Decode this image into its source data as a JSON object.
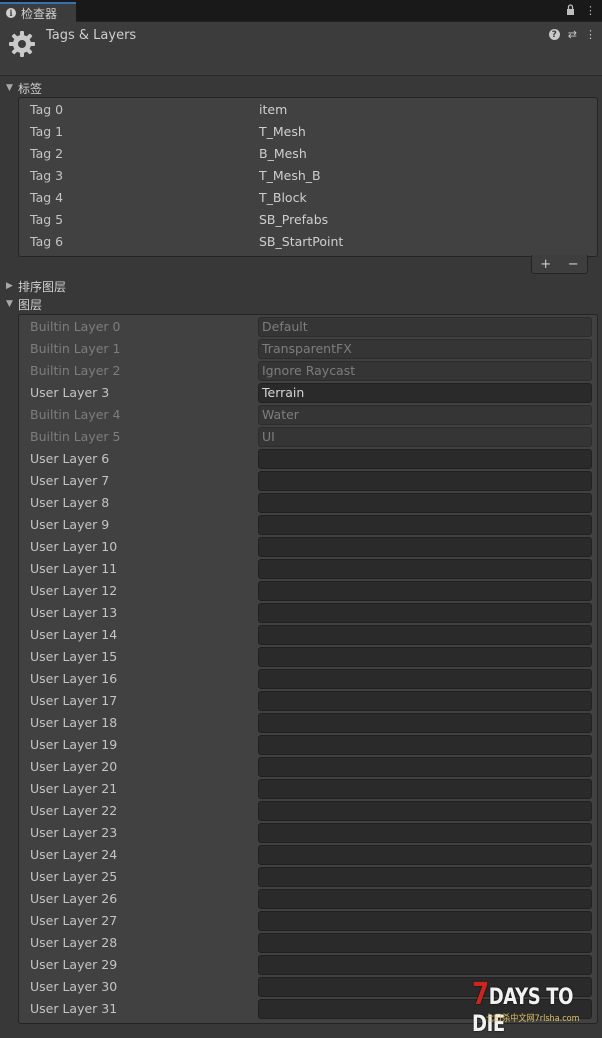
{
  "tab": {
    "label": "检查器"
  },
  "header": {
    "title": "Tags & Layers"
  },
  "tags_section": {
    "title": "标签",
    "items": [
      {
        "label": "Tag 0",
        "value": "item"
      },
      {
        "label": "Tag 1",
        "value": "T_Mesh"
      },
      {
        "label": "Tag 2",
        "value": "B_Mesh"
      },
      {
        "label": "Tag 3",
        "value": "T_Mesh_B"
      },
      {
        "label": "Tag 4",
        "value": "T_Block"
      },
      {
        "label": "Tag 5",
        "value": "SB_Prefabs"
      },
      {
        "label": "Tag 6",
        "value": "SB_StartPoint"
      }
    ],
    "add_label": "+",
    "remove_label": "−"
  },
  "sorting_section": {
    "title": "排序图层"
  },
  "layers_section": {
    "title": "图层",
    "items": [
      {
        "label": "Builtin Layer 0",
        "value": "Default",
        "disabled": true
      },
      {
        "label": "Builtin Layer 1",
        "value": "TransparentFX",
        "disabled": true
      },
      {
        "label": "Builtin Layer 2",
        "value": "Ignore Raycast",
        "disabled": true
      },
      {
        "label": "User Layer 3",
        "value": "Terrain",
        "disabled": false
      },
      {
        "label": "Builtin Layer 4",
        "value": "Water",
        "disabled": true
      },
      {
        "label": "Builtin Layer 5",
        "value": "UI",
        "disabled": true
      },
      {
        "label": "User Layer 6",
        "value": "",
        "disabled": false
      },
      {
        "label": "User Layer 7",
        "value": "",
        "disabled": false
      },
      {
        "label": "User Layer 8",
        "value": "",
        "disabled": false
      },
      {
        "label": "User Layer 9",
        "value": "",
        "disabled": false
      },
      {
        "label": "User Layer 10",
        "value": "",
        "disabled": false
      },
      {
        "label": "User Layer 11",
        "value": "",
        "disabled": false
      },
      {
        "label": "User Layer 12",
        "value": "",
        "disabled": false
      },
      {
        "label": "User Layer 13",
        "value": "",
        "disabled": false
      },
      {
        "label": "User Layer 14",
        "value": "",
        "disabled": false
      },
      {
        "label": "User Layer 15",
        "value": "",
        "disabled": false
      },
      {
        "label": "User Layer 16",
        "value": "",
        "disabled": false
      },
      {
        "label": "User Layer 17",
        "value": "",
        "disabled": false
      },
      {
        "label": "User Layer 18",
        "value": "",
        "disabled": false
      },
      {
        "label": "User Layer 19",
        "value": "",
        "disabled": false
      },
      {
        "label": "User Layer 20",
        "value": "",
        "disabled": false
      },
      {
        "label": "User Layer 21",
        "value": "",
        "disabled": false
      },
      {
        "label": "User Layer 22",
        "value": "",
        "disabled": false
      },
      {
        "label": "User Layer 23",
        "value": "",
        "disabled": false
      },
      {
        "label": "User Layer 24",
        "value": "",
        "disabled": false
      },
      {
        "label": "User Layer 25",
        "value": "",
        "disabled": false
      },
      {
        "label": "User Layer 26",
        "value": "",
        "disabled": false
      },
      {
        "label": "User Layer 27",
        "value": "",
        "disabled": false
      },
      {
        "label": "User Layer 28",
        "value": "",
        "disabled": false
      },
      {
        "label": "User Layer 29",
        "value": "",
        "disabled": false
      },
      {
        "label": "User Layer 30",
        "value": "",
        "disabled": false
      },
      {
        "label": "User Layer 31",
        "value": "",
        "disabled": false
      }
    ]
  },
  "watermark": {
    "main": "DAYS TO DIE",
    "number": "7",
    "sub": "七日杀中文网7rlsha.com"
  },
  "icons": {
    "tab": "info-icon",
    "header": "gear-icon",
    "lock": "lock-icon",
    "menu": "kebab-menu-icon",
    "help": "help-icon",
    "preset": "preset-icon"
  }
}
